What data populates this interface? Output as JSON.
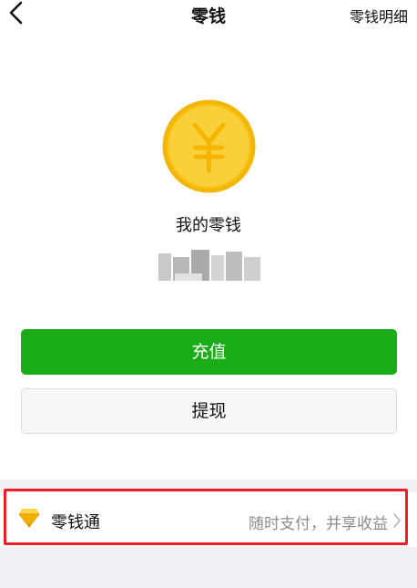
{
  "navbar": {
    "title": "零钱",
    "right_label": "零钱明细",
    "back_icon": "chevron-left-icon"
  },
  "balance": {
    "label": "我的零钱",
    "coin_icon": "yuan-coin-icon",
    "amount_state": "blurred"
  },
  "actions": {
    "recharge_label": "充值",
    "withdraw_label": "提现"
  },
  "lingqiantong": {
    "title": "零钱通",
    "description": "随时支付，并享收益",
    "icon": "diamond-icon",
    "chevron_icon": "chevron-right-icon"
  },
  "colors": {
    "primary_green": "#1aad19",
    "coin_gold": "#f8c51c",
    "coin_ring": "#f2b705",
    "highlight_red": "#e8202a",
    "page_gray": "#efeff4",
    "secondary_text": "#8c8c8c"
  }
}
